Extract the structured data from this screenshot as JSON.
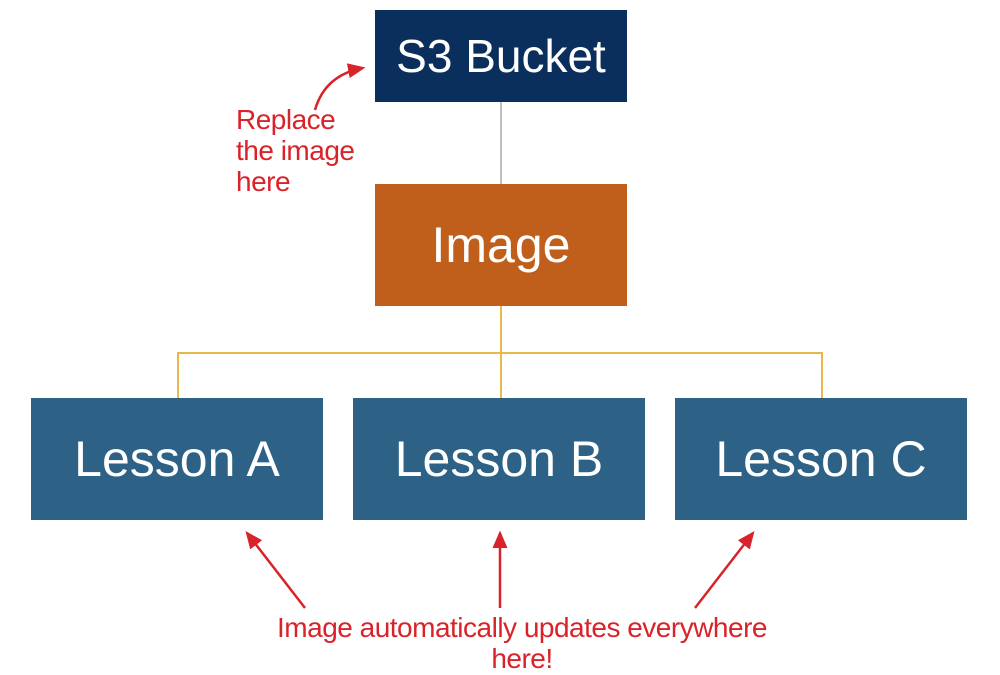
{
  "nodes": {
    "s3": "S3 Bucket",
    "image": "Image",
    "lessonA": "Lesson A",
    "lessonB": "Lesson B",
    "lessonC": "Lesson C"
  },
  "annotations": {
    "replace": "Replace the image here",
    "updates": "Image automatically updates everywhere here!"
  },
  "colors": {
    "s3": "#0a2f5c",
    "image": "#c05f1c",
    "lesson": "#2d6286",
    "annotation": "#d9232a",
    "connector_gray": "#bfbfbf",
    "connector_gold": "#e8b84a"
  }
}
